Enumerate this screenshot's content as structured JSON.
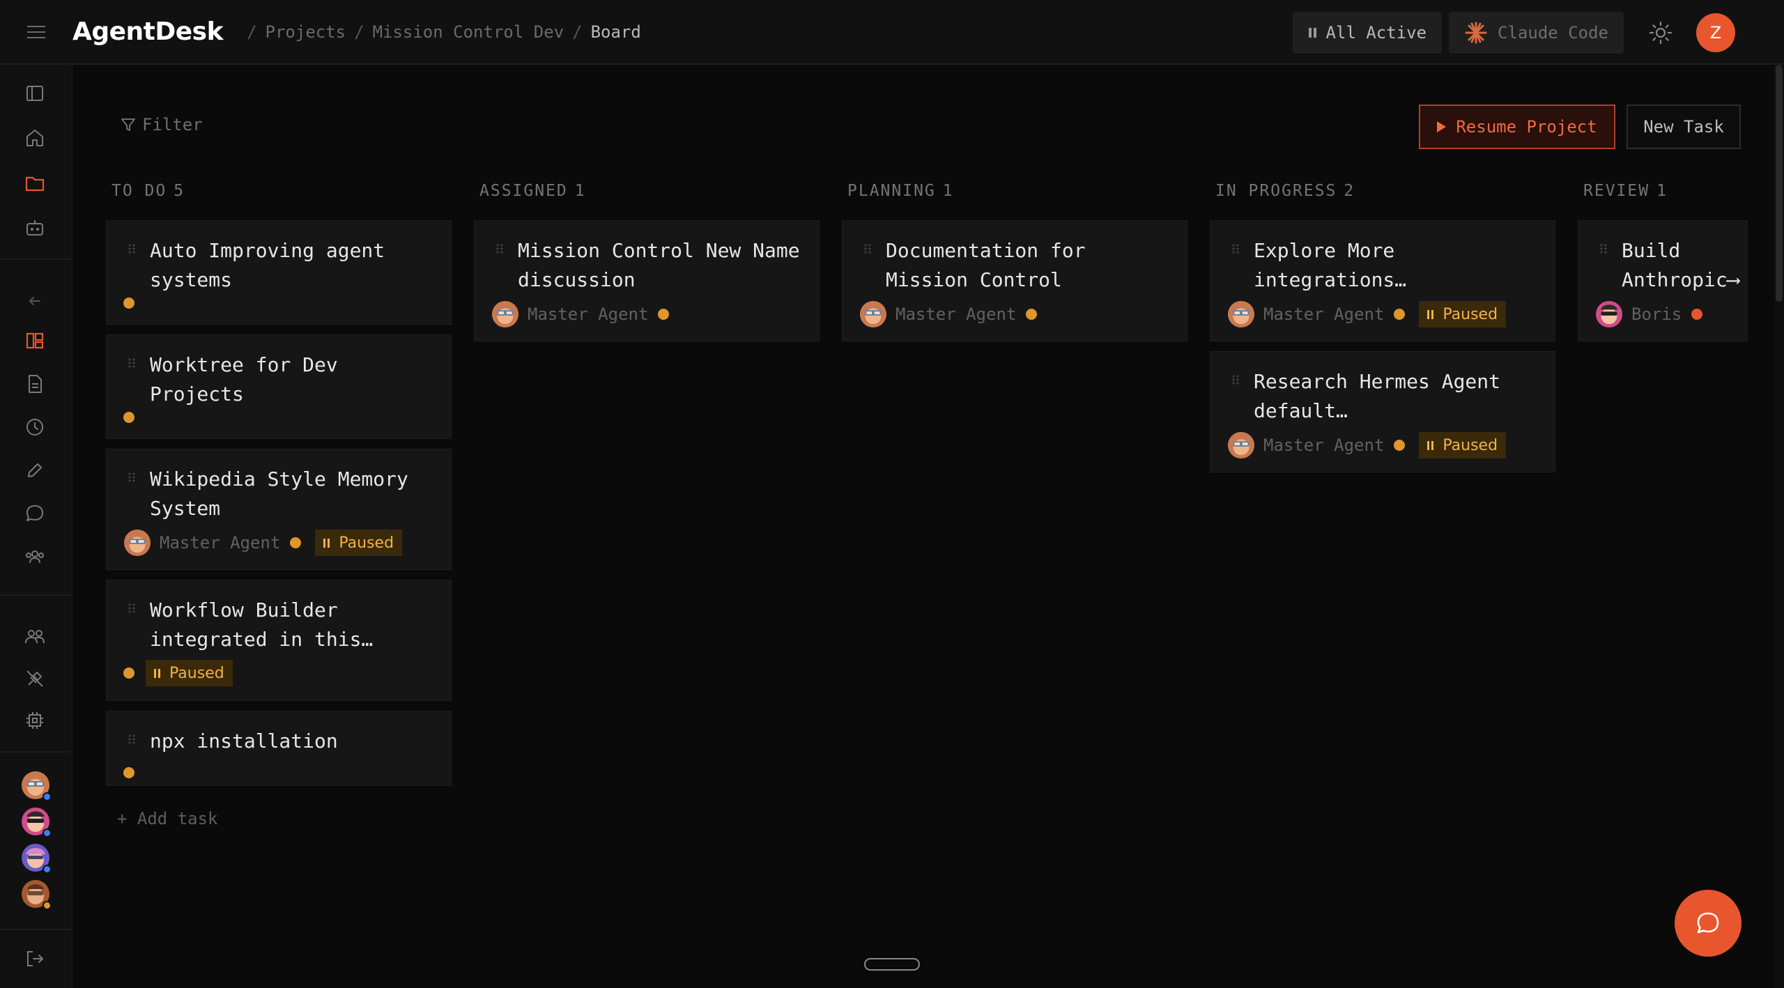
{
  "topbar": {
    "brand": "AgentDesk",
    "breadcrumb": [
      "Projects",
      "Mission Control Dev",
      "Board"
    ],
    "separator": "/",
    "all_active_label": "All Active",
    "claude_label": "Claude Code",
    "user_initial": "Z"
  },
  "toolbar": {
    "filter_label": "Filter",
    "resume_label": "Resume Project",
    "new_task_label": "New Task"
  },
  "columns": [
    {
      "name": "TO DO",
      "count": "5"
    },
    {
      "name": "ASSIGNED",
      "count": "1"
    },
    {
      "name": "PLANNING",
      "count": "1"
    },
    {
      "name": "IN PROGRESS",
      "count": "2"
    },
    {
      "name": "REVIEW",
      "count": "1"
    }
  ],
  "cards": {
    "todo": [
      {
        "title": "Auto Improving agent systems"
      },
      {
        "title": "Worktree for Dev Projects"
      },
      {
        "title": "Wikipedia Style Memory System",
        "agent": "Master Agent",
        "status": "Paused"
      },
      {
        "title": "Workflow Builder integrated in this…",
        "status": "Paused"
      },
      {
        "title": "npx installation"
      }
    ],
    "assigned": [
      {
        "title": "Mission Control New Name discussion",
        "agent": "Master Agent"
      }
    ],
    "planning": [
      {
        "title": "Documentation for Mission Control",
        "agent": "Master Agent"
      }
    ],
    "in_progress": [
      {
        "title": "Explore More integrations…",
        "agent": "Master Agent",
        "status": "Paused"
      },
      {
        "title": "Research Hermes Agent default…",
        "agent": "Master Agent",
        "status": "Paused"
      }
    ],
    "review": [
      {
        "title": "Build Anthropic⟶",
        "agent": "Boris"
      }
    ]
  },
  "add_task_label": "+ Add task",
  "colors": {
    "accent": "#e8562e",
    "pending_dot": "#e0962c",
    "paused_badge_bg": "#3a2a0a",
    "paused_badge_text": "#f2b24a",
    "online": "#3b7ff5"
  },
  "sidebar_icons": [
    "panel-toggle-icon",
    "home-icon",
    "folder-icon",
    "robot-icon",
    "back-arrow-icon",
    "board-icon",
    "document-icon",
    "clock-icon",
    "pencil-icon",
    "chat-icon",
    "team-icon",
    "people-icon",
    "plug-off-icon",
    "chip-icon",
    "logout-icon"
  ]
}
